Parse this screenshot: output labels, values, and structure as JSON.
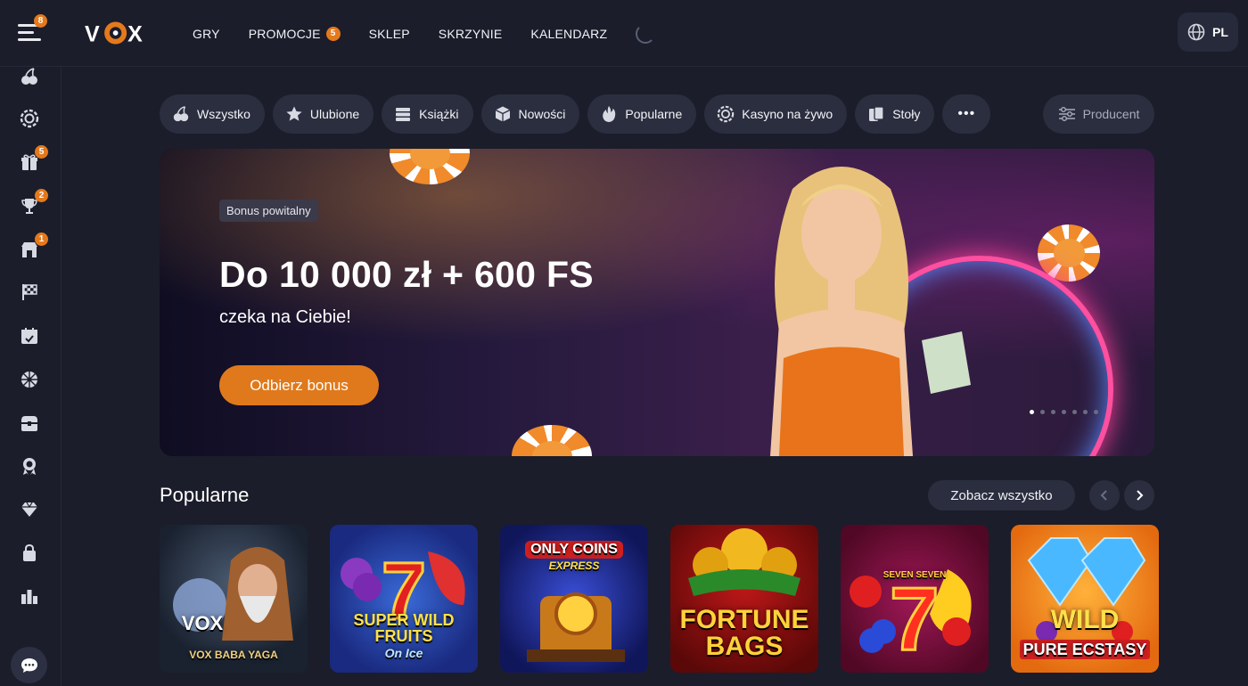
{
  "header": {
    "menu_badge": "8",
    "logo": "VOX",
    "nav": [
      {
        "label": "GRY"
      },
      {
        "label": "PROMOCJE",
        "badge": "5"
      },
      {
        "label": "SKLEP"
      },
      {
        "label": "SKRZYNIE"
      },
      {
        "label": "KALENDARZ"
      }
    ],
    "language": "PL"
  },
  "sidebar": {
    "items": [
      {
        "icon": "cherries-icon"
      },
      {
        "icon": "poker-chip-icon"
      },
      {
        "icon": "gift-icon",
        "badge": "5"
      },
      {
        "icon": "trophy-icon",
        "badge": "2"
      },
      {
        "icon": "shop-icon",
        "badge": "1"
      },
      {
        "icon": "racing-flag-icon"
      },
      {
        "icon": "calendar-icon"
      },
      {
        "icon": "wheel-icon"
      },
      {
        "icon": "treasure-chest-icon"
      },
      {
        "icon": "award-ribbon-icon"
      },
      {
        "icon": "diamond-icon"
      },
      {
        "icon": "bag-icon"
      },
      {
        "icon": "leaderboard-icon"
      }
    ],
    "chat_icon": "chat-icon"
  },
  "filters": {
    "chips": [
      {
        "label": "Wszystko",
        "icon": "cherries-icon"
      },
      {
        "label": "Ulubione",
        "icon": "star-icon"
      },
      {
        "label": "Książki",
        "icon": "books-icon"
      },
      {
        "label": "Nowości",
        "icon": "cube-icon"
      },
      {
        "label": "Popularne",
        "icon": "fire-icon"
      },
      {
        "label": "Kasyno na żywo",
        "icon": "poker-chip-icon"
      },
      {
        "label": "Stoły",
        "icon": "cards-icon"
      }
    ],
    "more_label": "•••",
    "producer_label": "Producent"
  },
  "banner": {
    "tag": "Bonus powitalny",
    "headline": "Do 10 000 zł + 600 FS",
    "subline": "czeka na Ciebie!",
    "cta": "Odbierz bonus",
    "slides_total": 7,
    "active_slide": 1
  },
  "popular": {
    "title": "Popularne",
    "see_all": "Zobacz wszystko",
    "games": [
      {
        "title": "VOX BABA YAGA",
        "badge": "VOX"
      },
      {
        "title": "SUPER WILD FRUITS",
        "subtitle": "On Ice"
      },
      {
        "title": "ONLY COINS",
        "subtitle": "EXPRESS"
      },
      {
        "title": "FORTUNE",
        "subtitle": "BAGS"
      },
      {
        "title": "SEVEN SEVEN"
      },
      {
        "title": "WILD",
        "subtitle": "PURE ECSTASY"
      }
    ]
  },
  "colors": {
    "accent": "#e4791c",
    "background": "#1b1d2a",
    "chip": "#2b2e3f"
  }
}
